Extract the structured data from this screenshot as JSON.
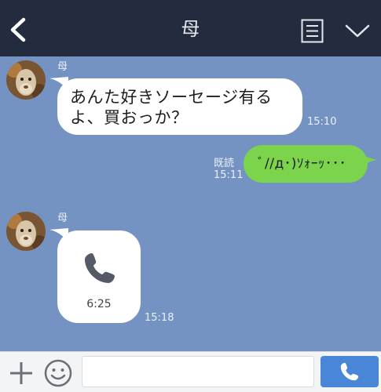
{
  "header": {
    "title": "母",
    "icons": {
      "back": "chevron-left-icon",
      "menu": "note-menu-icon",
      "expand": "chevron-down-icon"
    }
  },
  "messages": [
    {
      "sender": "母",
      "type": "text",
      "lines": [
        "あんた好きソーセージ有る",
        "よ、買おっか？"
      ],
      "time": "15:10"
    },
    {
      "sender": "me",
      "type": "text",
      "text": "ﾞ//д･)ｿｫｰｯ･･･",
      "read": "既読",
      "time": "15:11"
    },
    {
      "sender": "母",
      "type": "call",
      "duration": "6:25",
      "icon": "phone-icon",
      "time": "15:18"
    }
  ],
  "input_bar": {
    "placeholder": "",
    "icons": {
      "add": "plus-icon",
      "emoji": "smiley-icon",
      "call": "phone-icon"
    }
  },
  "colors": {
    "header_bg": "#232b3f",
    "chat_bg": "#7593c2",
    "my_bubble": "#7bd44c",
    "call_button": "#4a86d8"
  }
}
